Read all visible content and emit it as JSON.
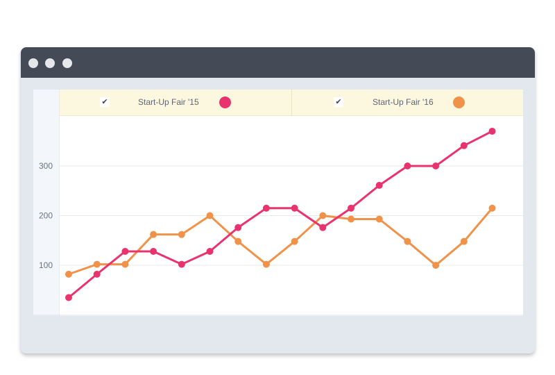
{
  "window": {
    "controls": [
      "window-control-dot",
      "window-control-dot",
      "window-control-dot"
    ],
    "colors": {
      "titlebar": "#454a57",
      "frame": "#e3e8ef"
    }
  },
  "legend": {
    "items": [
      {
        "label": "Start-Up Fair '15",
        "checked": true,
        "color": "#e8336e",
        "check_icon": "checkmark-icon"
      },
      {
        "label": "Start-Up Fair '16",
        "checked": true,
        "color": "#f0924a",
        "check_icon": "checkmark-icon"
      }
    ]
  },
  "chart_data": {
    "type": "line",
    "x": [
      1,
      2,
      3,
      4,
      5,
      6,
      7,
      8,
      9,
      10,
      11,
      12,
      13,
      14,
      15,
      16
    ],
    "xlabel": "",
    "ylabel": "",
    "ylim": [
      0,
      390
    ],
    "yticks": [
      "100",
      "200",
      "300"
    ],
    "ytick_values": [
      100,
      200,
      300
    ],
    "grid": true,
    "legend_position": "top",
    "series": [
      {
        "name": "Start-Up Fair '15",
        "color": "#e8336e",
        "values": [
          35,
          82,
          128,
          128,
          102,
          128,
          176,
          215,
          215,
          176,
          215,
          261,
          300,
          300,
          341,
          370
        ]
      },
      {
        "name": "Start-Up Fair '16",
        "color": "#f0924a",
        "values": [
          82,
          102,
          102,
          162,
          162,
          200,
          148,
          102,
          148,
          200,
          193,
          193,
          148,
          100,
          148,
          215
        ]
      }
    ]
  }
}
